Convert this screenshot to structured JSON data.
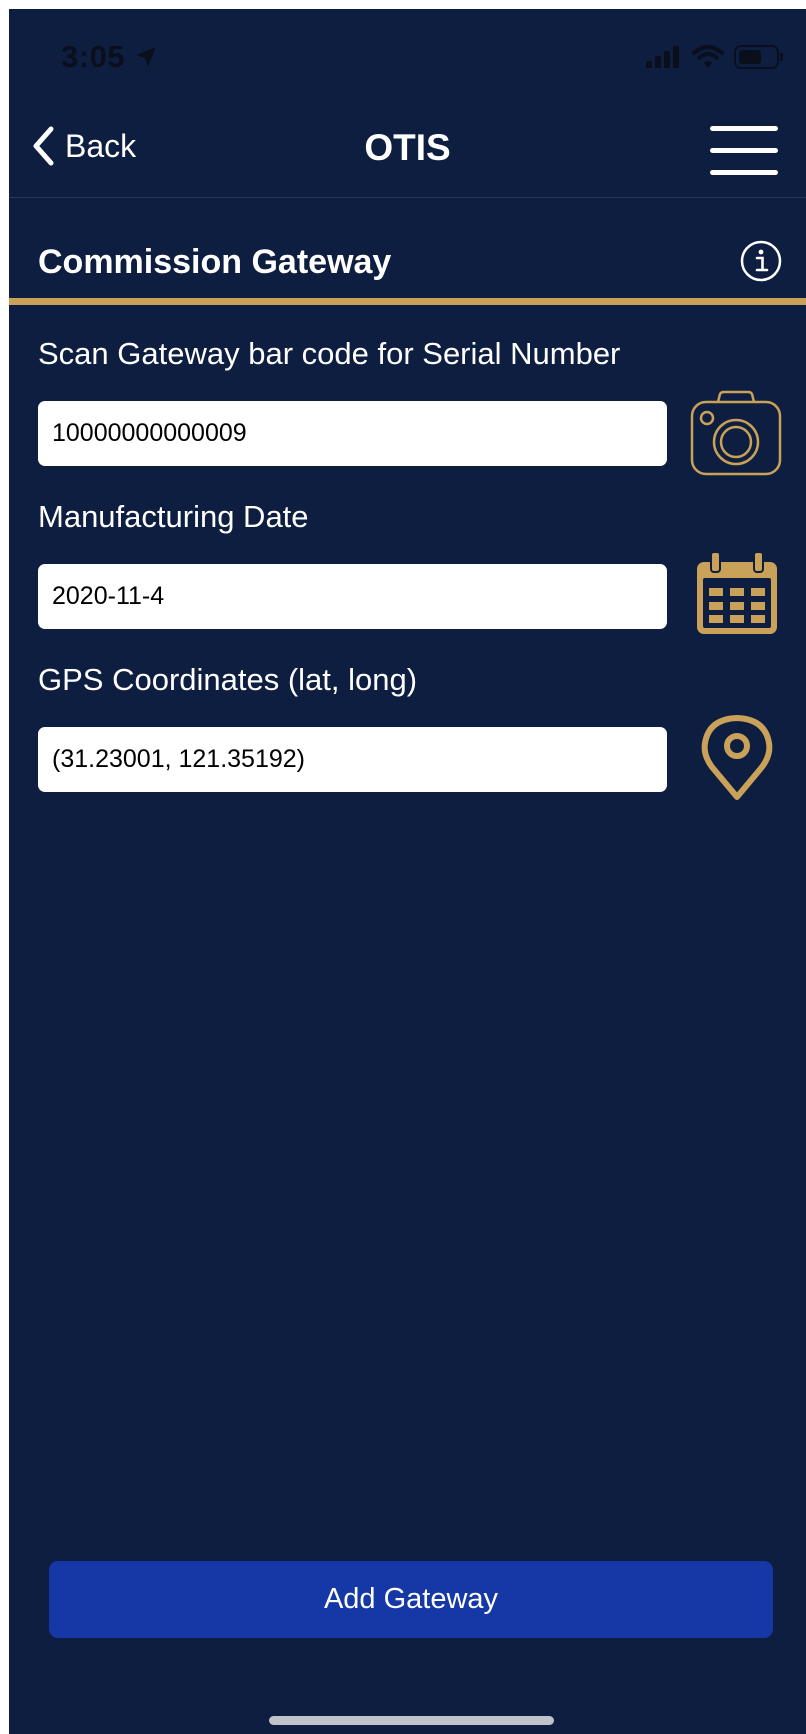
{
  "status_bar": {
    "time": "3:05",
    "location_icon": "location-arrow-icon",
    "signal_icon": "cellular-signal-icon",
    "wifi_icon": "wifi-icon",
    "battery_icon": "battery-icon"
  },
  "nav": {
    "back_label": "Back",
    "title": "OTIS",
    "menu_icon": "hamburger-menu-icon"
  },
  "section": {
    "title": "Commission Gateway",
    "info_icon": "info-icon"
  },
  "form": {
    "serial": {
      "label": "Scan Gateway bar code for Serial Number",
      "value": "10000000000009",
      "icon": "camera-icon"
    },
    "manufacturing_date": {
      "label": "Manufacturing Date",
      "value": "2020-11-4",
      "icon": "calendar-icon"
    },
    "gps": {
      "label": "GPS Coordinates (lat, long)",
      "value": "(31.23001, 121.35192)",
      "icon": "location-pin-icon"
    }
  },
  "actions": {
    "add_label": "Add Gateway"
  },
  "colors": {
    "background": "#0e1e40",
    "accent_gold": "#c9a158",
    "primary_button": "#1538a6",
    "text": "#ffffff"
  }
}
